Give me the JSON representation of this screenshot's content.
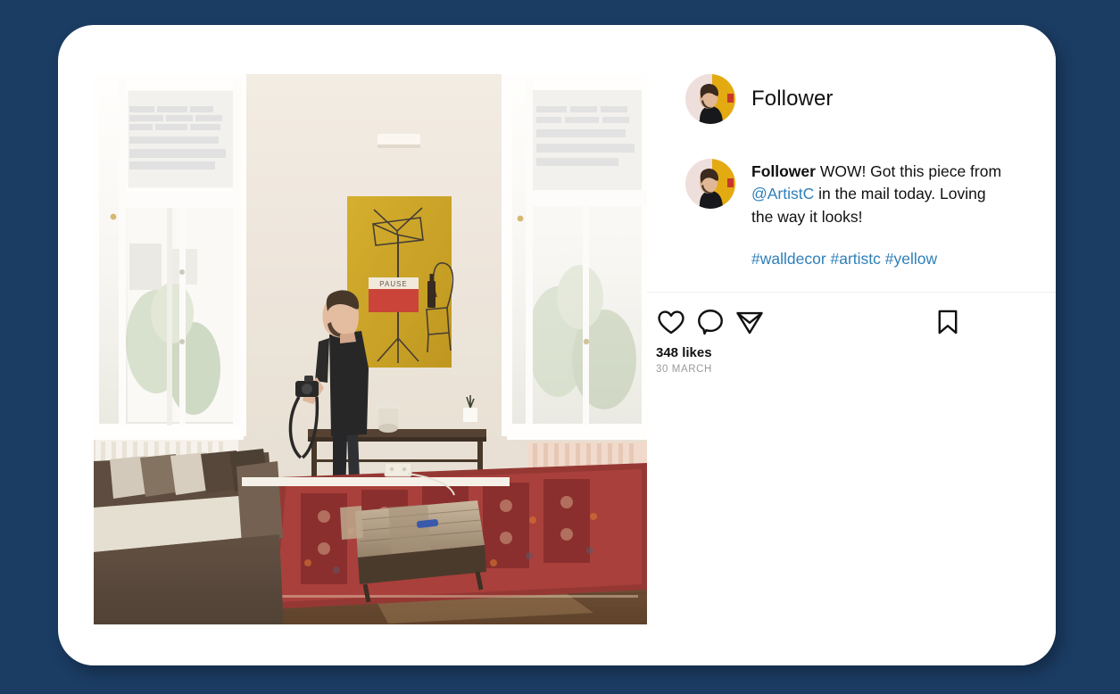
{
  "theme": {
    "page_background": "#1b3c63",
    "card_background": "#ffffff",
    "link_color": "#2f7fb8",
    "muted_text": "#9a9a9a",
    "divider": "#efefef"
  },
  "post": {
    "header": {
      "username": "Follower",
      "avatar_name": "user-avatar"
    },
    "caption": {
      "author": "Follower",
      "text_before_mention": " WOW! Got this piece from ",
      "mention": "@ArtistC",
      "text_after_mention": " in the mail today. Loving the way it looks!",
      "hashtags": "#walldecor #artistc #yellow"
    },
    "actions": {
      "like": "like-icon",
      "comment": "comment-icon",
      "share": "share-icon",
      "save": "bookmark-icon"
    },
    "meta": {
      "likes": "348 likes",
      "date": "30 MARCH"
    },
    "photo": {
      "alt": "Man in black t-shirt holding a camera standing in a bright living room with two tall windows, a yellow painting on the wall, brown sofa and red patterned rug",
      "colors": {
        "wall": "#eee7de",
        "window_light": "#fbfafa",
        "artwork_yellow": "#c8a11c",
        "pause_red": "#c8372e",
        "sofa_brown": "#4b3b32",
        "rug_red": "#9c2f2c",
        "floor_wood": "#6e4a2e",
        "shirt_black": "#1a1a1a"
      }
    }
  }
}
